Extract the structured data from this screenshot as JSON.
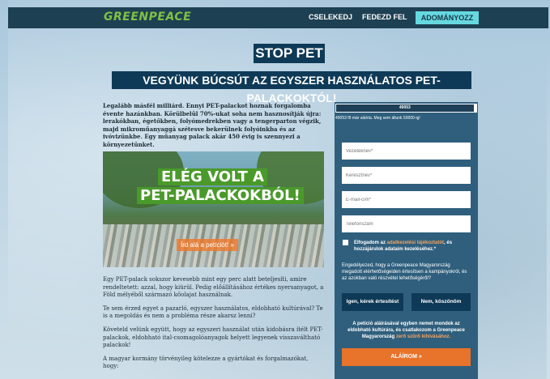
{
  "nav": {
    "logo": "GREENPEACE",
    "links": [
      "CSELEKEDJ",
      "FEDEZD FEL"
    ],
    "donate": "ADOMÁNYOZZ"
  },
  "header": {
    "title": "STOP PET",
    "subtitle": "VEGYÜNK BÚCSÚT AZ EGYSZER HASZNÁLATOS PET-PALACKOKTÓL!"
  },
  "article": {
    "lead": "Legalább másfél milliárd. Ennyi PET-palackot hoznak forgalomba évente hazánkban. Körülbelül 70%-ukat soha nem hasznosítják újra: lerakókban, égetőkben, folyómedrekben vagy a tengerparton végzik, majd mikroműanyaggá szétesve bekerülnek folyóinkba és az ivóvizünkbe. Egy műanyag palack akár 450 évig is szennyezi a környezetünket.",
    "hero_line1": "ELÉG VOLT A",
    "hero_line2": "PET-PALACKOKBÓL!",
    "hero_button": "Írd alá a petíciót! »",
    "p1": "Egy PET-palack sokszor kevesebb mint egy perc alatt beteljesíti, amire rendeltetett: azzal, hogy kiürül. Pedig előállításához értékes nyersanyagot, a Föld mélyéből származó kőolajat használnak.",
    "p2": "Te sem érzed egyet a pazarló, egyszer használatos, eldobható kultúrával? Te is a megoldás és nem a probléma része akarsz lenni?",
    "p3": "Követeld velünk együtt, hogy az egyszeri használat után kidobásra ítélt PET-palackok, eldobható ital-csomagolóanyagok helyett legyenek visszaváltható palackok!",
    "p4": "A magyar kormány törvényileg kötelezze a gyártókat és forgalmazókat, hogy:"
  },
  "form": {
    "progress": {
      "value": 49053,
      "goal": 50000,
      "label": "49053",
      "caption": "49053 fő már aláírta. Meg sem állunk 50000-ig!"
    },
    "fields": [
      {
        "placeholder": "Vezetéknév*"
      },
      {
        "placeholder": "Keresztnév*"
      },
      {
        "placeholder": "E-mail-cím*"
      },
      {
        "placeholder": "Telefonszám"
      }
    ],
    "consent_pre": "Elfogadom az ",
    "consent_link": "adatkezelési tájékoztatót",
    "consent_post": ", és hozzájárulok adataim kezeléséhez.*",
    "notify_text": "Engedélyezed, hogy a Greenpeace Magyarország megadott elérhetőségeiden értesítsen a kampányokról, és az azokban való részvétel lehetőségéről?",
    "yes_button": "Igen, kérek értesítést",
    "no_button": "Nem, köszönöm",
    "pledge_pre": "A petíció aláírásával egyben nemet mondok az eldobható kultúrára, és csatlakozom a Greenpeace Magyarország ",
    "pledge_link": "zerő szűrő kihívásához.",
    "submit": "ALÁÍROM »"
  }
}
